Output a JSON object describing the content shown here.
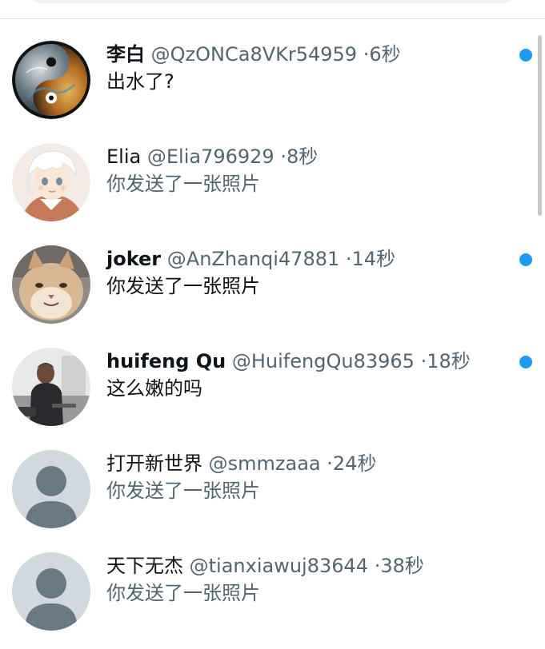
{
  "theme": {
    "accent": "#1d9bf0",
    "text_primary": "#0f1419",
    "text_secondary": "#536471",
    "default_avatar_bg": "#cfd9de",
    "default_avatar_fg": "#697984"
  },
  "conversations": [
    {
      "name": "李白",
      "handle": "@QzONCa8VKr54959",
      "separator": "·",
      "time": "6秒",
      "preview": "出水了?",
      "unread": true,
      "avatar": "yin-yang-avatar"
    },
    {
      "name": "Elia",
      "handle": "@Elia796929",
      "separator": "·",
      "time": "8秒",
      "preview": "你发送了一张照片",
      "unread": false,
      "avatar": "anime-boy-avatar"
    },
    {
      "name": "joker",
      "handle": "@AnZhanqi47881",
      "separator": "·",
      "time": "14秒",
      "preview": "你发送了一张照片",
      "unread": true,
      "avatar": "cat-face-avatar"
    },
    {
      "name": "huifeng Qu",
      "handle": "@HuifengQu83965",
      "separator": "·",
      "time": "18秒",
      "preview": "这么嫩的吗",
      "unread": true,
      "avatar": "man-photo-avatar"
    },
    {
      "name": "打开新世界",
      "handle": "@smmzaaa",
      "separator": "·",
      "time": "24秒",
      "preview": "你发送了一张照片",
      "unread": false,
      "avatar": "default-avatar"
    },
    {
      "name": "天下无杰",
      "handle": "@tianxiawuj83644",
      "separator": "·",
      "time": "38秒",
      "preview": "你发送了一张照片",
      "unread": false,
      "avatar": "default-avatar"
    }
  ]
}
